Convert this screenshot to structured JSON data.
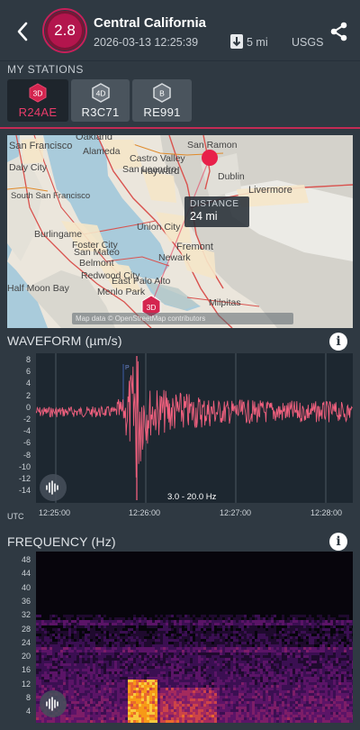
{
  "header": {
    "magnitude": "2.8",
    "title": "Central California",
    "datetime": "2026-03-13 12:25:39",
    "depth": "5 mi",
    "source": "USGS"
  },
  "stations": {
    "label": "MY STATIONS",
    "items": [
      {
        "badge": "3D",
        "name": "R24AE",
        "active": true
      },
      {
        "badge": "4D",
        "name": "R3C71",
        "active": false
      },
      {
        "badge": "B",
        "name": "RE991",
        "active": false
      }
    ]
  },
  "map": {
    "places": [
      "San Francisco",
      "Oakland",
      "Alameda",
      "San Leandro",
      "Castro Valley",
      "Hayward",
      "Union City",
      "Fremont",
      "Newark",
      "San Ramon",
      "Dublin",
      "Livermore",
      "Burlingame",
      "Foster City",
      "San Mateo",
      "Belmont",
      "Redwood City",
      "Menlo Park",
      "East Palo Alto",
      "Half Moon Bay",
      "Milpitas",
      "Daly City",
      "South San Francisco"
    ],
    "distance_label": "DISTANCE",
    "distance_value": "24 mi",
    "station_badge": "3D",
    "attribution": "Map data © OpenStreetMap contributors"
  },
  "waveform": {
    "title": "WAVEFORM (µm/s)",
    "y_ticks": [
      "8",
      "6",
      "4",
      "2",
      "0",
      "-2",
      "-4",
      "-6",
      "-8",
      "-10",
      "-12",
      "-14"
    ],
    "x_ticks": [
      "12:25:00",
      "12:26:00",
      "12:27:00",
      "12:28:00"
    ],
    "utc": "UTC",
    "filter": "3.0 - 20.0 Hz",
    "p_marker": "P",
    "color": "#f0607e"
  },
  "frequency": {
    "title": "FREQUENCY (Hz)",
    "y_ticks": [
      "48",
      "44",
      "40",
      "36",
      "32",
      "28",
      "24",
      "20",
      "16",
      "12",
      "8",
      "4"
    ]
  },
  "colors": {
    "accent": "#c42b55",
    "background": "#2f3942",
    "plot_bg": "#1d2730"
  }
}
